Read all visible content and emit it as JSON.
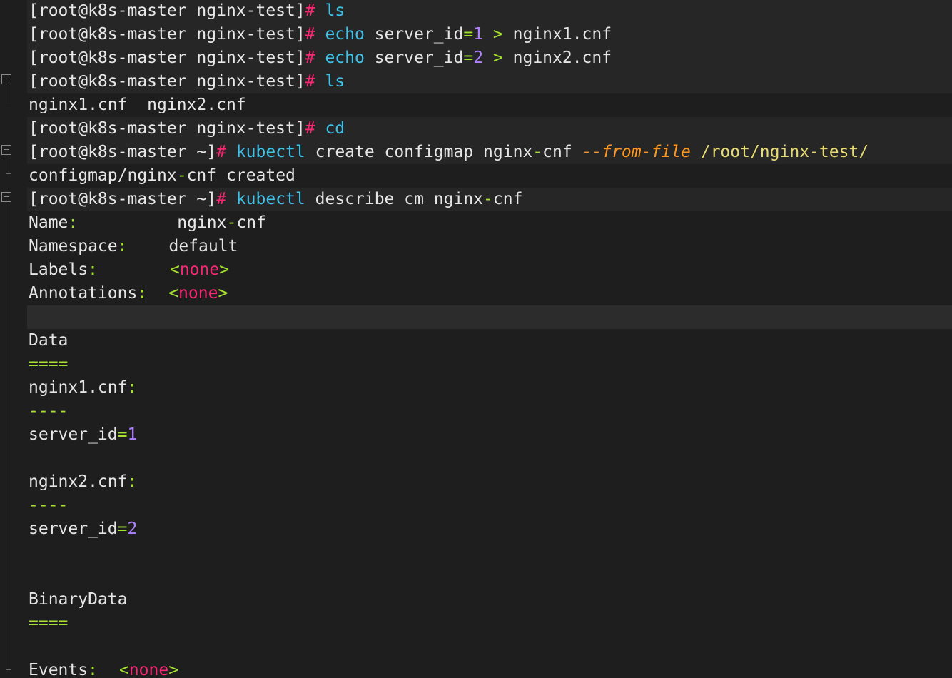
{
  "terminal": {
    "prompt_dir": "[root@k8s-master nginx-test]",
    "prompt_home": "[root@k8s-master ~]",
    "hash": "#",
    "lines": {
      "l1_cmd": "ls",
      "l2_cmd": "echo",
      "l2_arg1": "server_id",
      "l2_eq": "=",
      "l2_num": "1",
      "l2_gt": ">",
      "l2_file": "nginx1.cnf",
      "l3_cmd": "echo",
      "l3_arg1": "server_id",
      "l3_eq": "=",
      "l3_num": "2",
      "l3_gt": ">",
      "l3_file": "nginx2.cnf",
      "l4_cmd": "ls",
      "l5_out": "nginx1.cnf  nginx2.cnf",
      "l6_cmd": "cd",
      "l7_cmd": "kubectl",
      "l7_rest1": "create configmap nginx",
      "l7_dash": "-",
      "l7_rest2": "cnf",
      "l7_flag": "--from-file",
      "l7_path": "/root/nginx-test/",
      "l8_out1": "configmap/nginx",
      "l8_dash": "-",
      "l8_out2": "cnf created",
      "l9_cmd": "kubectl",
      "l9_rest1": "describe cm nginx",
      "l9_dash": "-",
      "l9_rest2": "cnf",
      "name_key": "Name",
      "name_val1": "nginx",
      "name_dash": "-",
      "name_val2": "cnf",
      "ns_key": "Namespace",
      "ns_val": "default",
      "labels_key": "Labels",
      "annotations_key": "Annotations",
      "none_open": "<",
      "none_word": "none",
      "none_close": ">",
      "colon": ":",
      "data_header": "Data",
      "data_rule": "====",
      "file1": "nginx1.cnf",
      "sub_rule": "----",
      "sid_key": "server_id",
      "sid_eq": "=",
      "sid_1": "1",
      "file2": "nginx2.cnf",
      "sid_2": "2",
      "binary_header": "BinaryData",
      "binary_rule": "====",
      "events_key": "Events"
    }
  },
  "colors": {
    "background": "#1e1e1e",
    "hash": "#f92672",
    "command": "#3fc1e8",
    "number": "#ae81ff",
    "operator": "#a6e22e",
    "flag": "#fd971f",
    "path": "#e6db74"
  }
}
